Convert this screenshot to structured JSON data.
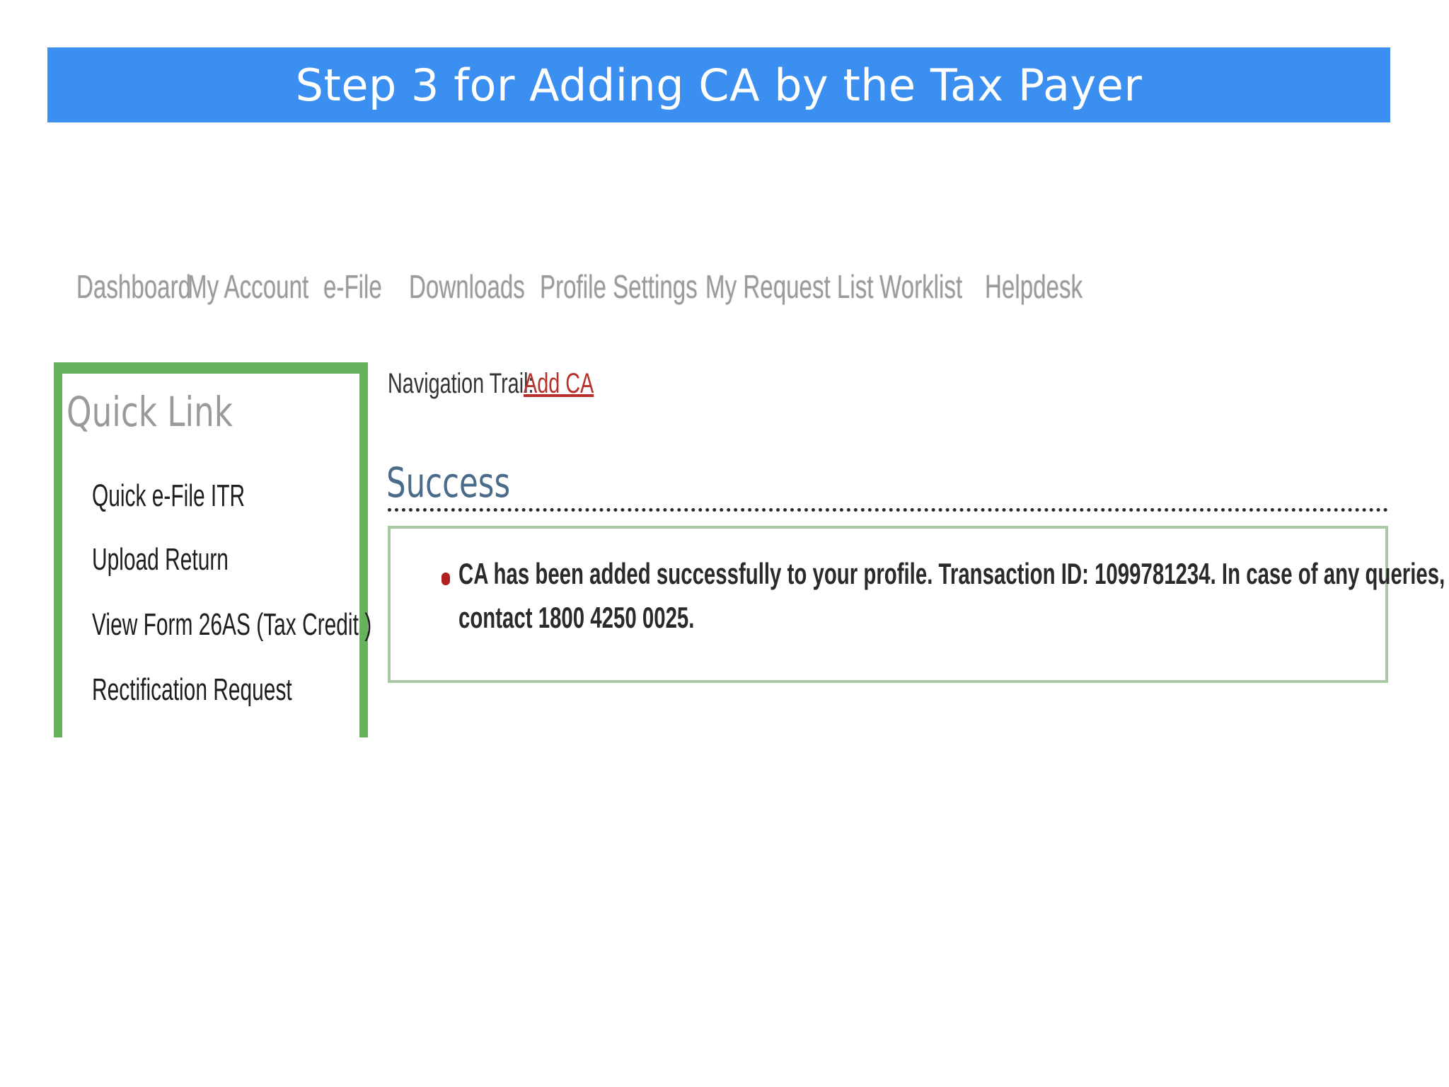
{
  "slide": {
    "title": "Step 3 for Adding CA by the Tax Payer"
  },
  "nav": {
    "items": [
      {
        "label": "Dashboard",
        "icon": ""
      },
      {
        "label": "My Account",
        "icon": ""
      },
      {
        "label": "e-File",
        "icon": ""
      },
      {
        "label": "Downloads",
        "icon": ""
      },
      {
        "label": "Profile Settings",
        "icon": ""
      },
      {
        "label": "My Request List",
        "icon": ""
      },
      {
        "label": "Worklist",
        "icon": ""
      },
      {
        "label": "Helpdesk",
        "icon": ""
      }
    ]
  },
  "quick_link": {
    "title": "Quick Link",
    "items": [
      "Quick e-File ITR",
      "Upload Return",
      "View Form 26AS (Tax Credit )",
      "Rectification Request"
    ]
  },
  "trail": {
    "label": "Navigation Trail:",
    "link": "Add CA"
  },
  "result": {
    "heading": "Success",
    "message_line1": "CA has been added successfully to your profile. Transaction ID: 1099781234. In case of any queries, please",
    "message_line2": "contact 1800 4250 0025."
  },
  "colors": {
    "title_bar": "#3a8ff0",
    "quick_link_border": "#66b25c",
    "message_border": "#a9c9a5",
    "trail_link": "#b5312a",
    "bullet": "#b11f1f"
  }
}
